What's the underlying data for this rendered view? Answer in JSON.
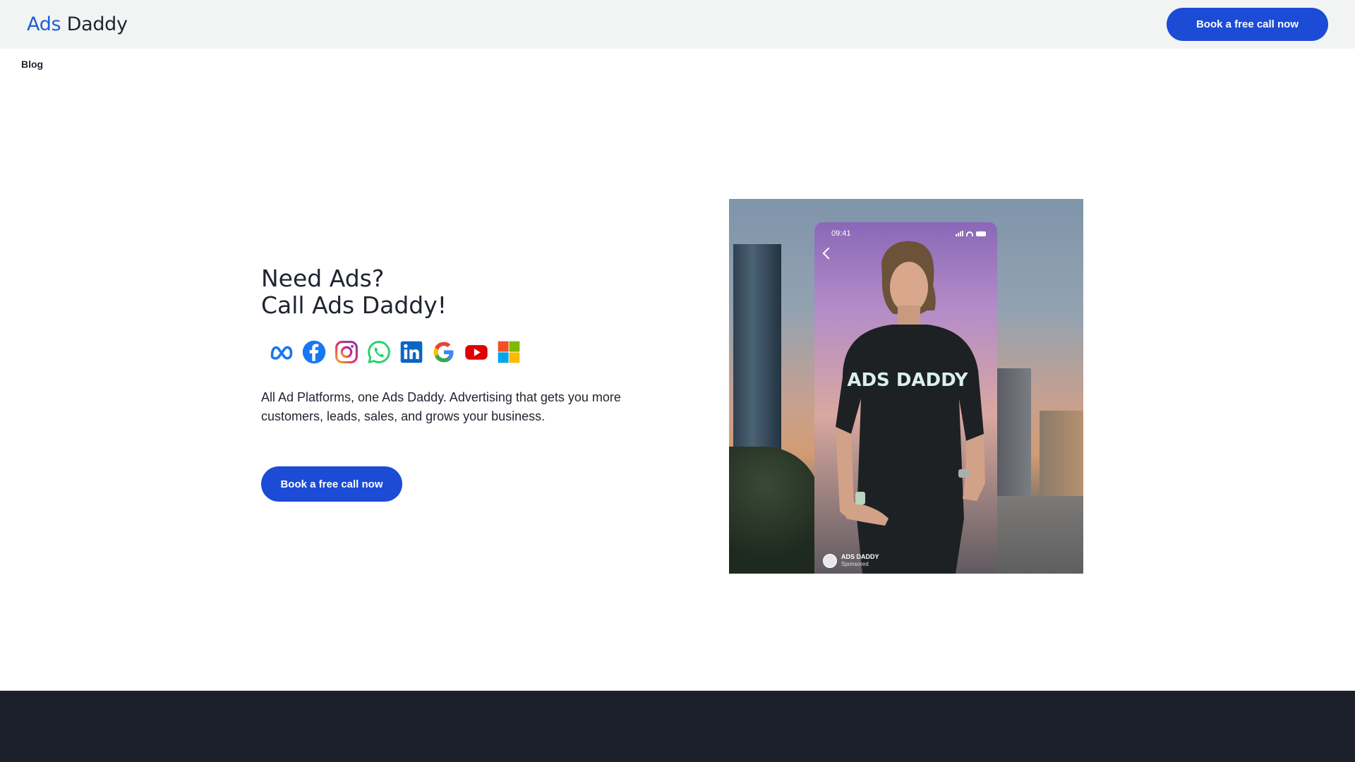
{
  "header": {
    "logo_word1": "Ads",
    "logo_word2": "Daddy",
    "cta_label": "Book a free call now"
  },
  "nav": {
    "blog_label": "Blog"
  },
  "hero": {
    "headline_line1": "Need Ads?",
    "headline_line2": "Call Ads Daddy!",
    "platform_icons": [
      "meta-icon",
      "facebook-icon",
      "instagram-icon",
      "whatsapp-icon",
      "linkedin-icon",
      "google-icon",
      "youtube-icon",
      "microsoft-icon"
    ],
    "description": "All Ad Platforms, one Ads Daddy. Advertising that gets you more customers, leads, sales, and grows your business.",
    "cta_label": "Book a free call now"
  },
  "ad_preview": {
    "status_time": "09:41",
    "shirt_text": "ADS DADDY",
    "account_name": "ADS DADDY",
    "sponsored_label": "Sponsored"
  },
  "colors": {
    "brand_blue": "#1c4bd6",
    "logo_blue": "#1d5fd6",
    "topbar_bg": "#f2f4f3",
    "footer_bg": "#1b202a",
    "text": "#1f2430"
  }
}
